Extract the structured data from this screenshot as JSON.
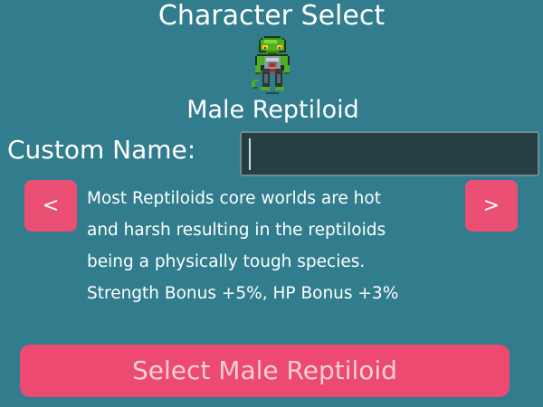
{
  "screen": {
    "title": "Character Select"
  },
  "character": {
    "sprite_icon": "reptiloid-sprite-icon",
    "species_name": "Male Reptiloid",
    "description_lines": [
      "Most Reptiloids core worlds are hot",
      "and harsh resulting in the reptiloids",
      "being a physically tough species.",
      "Strength Bonus +5%, HP Bonus +3%"
    ]
  },
  "custom_name": {
    "label": "Custom Name:",
    "value": ""
  },
  "navigation": {
    "prev_label": "<",
    "next_label": ">"
  },
  "actions": {
    "select_label": "Select Male Reptiloid"
  },
  "colors": {
    "background": "#317d8d",
    "button": "#ec4f74",
    "input_background": "#263f45"
  }
}
